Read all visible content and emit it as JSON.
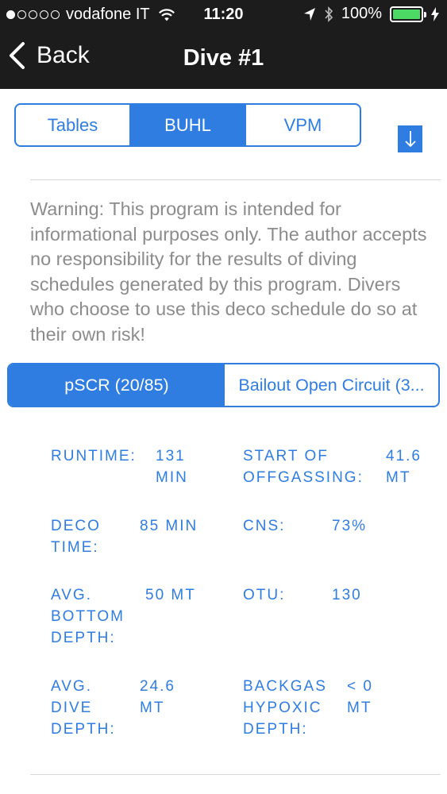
{
  "status_bar": {
    "carrier": "vodafone IT",
    "time": "11:20",
    "battery": "100%",
    "signal_bars_filled": 1,
    "signal_bars_total": 5
  },
  "nav": {
    "back_label": "Back",
    "title": "Dive #1"
  },
  "algorithm_tabs": {
    "options": [
      "Tables",
      "BUHL",
      "VPM"
    ],
    "selected": "BUHL"
  },
  "warning_text": "Warning: This program is intended for informational purposes only. The author accepts no responsibility for the results of diving schedules generated by this program. Divers who choose to use this deco schedule do so at their own risk!",
  "gas_tabs": {
    "options": [
      "pSCR (20/85)",
      "Bailout Open Circuit (3..."
    ],
    "selected": "pSCR (20/85)"
  },
  "stats": {
    "runtime": {
      "label": "RUNTIME:",
      "value": "131 MIN"
    },
    "deco_time": {
      "label": "DECO TIME:",
      "value": "85 MIN"
    },
    "avg_bottom_depth": {
      "label": "AVG. BOTTOM DEPTH:",
      "value": "50 MT"
    },
    "avg_dive_depth": {
      "label": "AVG. DIVE DEPTH:",
      "value": "24.6 MT"
    },
    "start_of_offgassing": {
      "label": "START OF OFFGASSING:",
      "value": "41.6 MT"
    },
    "cns": {
      "label": "CNS:",
      "value": "73%"
    },
    "otu": {
      "label": "OTU:",
      "value": "130"
    },
    "backgas_hypoxic_depth": {
      "label": "BACKGAS HYPOXIC DEPTH:",
      "value": "< 0 MT"
    }
  },
  "colors": {
    "accent": "#2f7de1",
    "nav_background": "#1c1c1c",
    "warning_text": "#8c8c8c",
    "battery": "#4cd964"
  }
}
